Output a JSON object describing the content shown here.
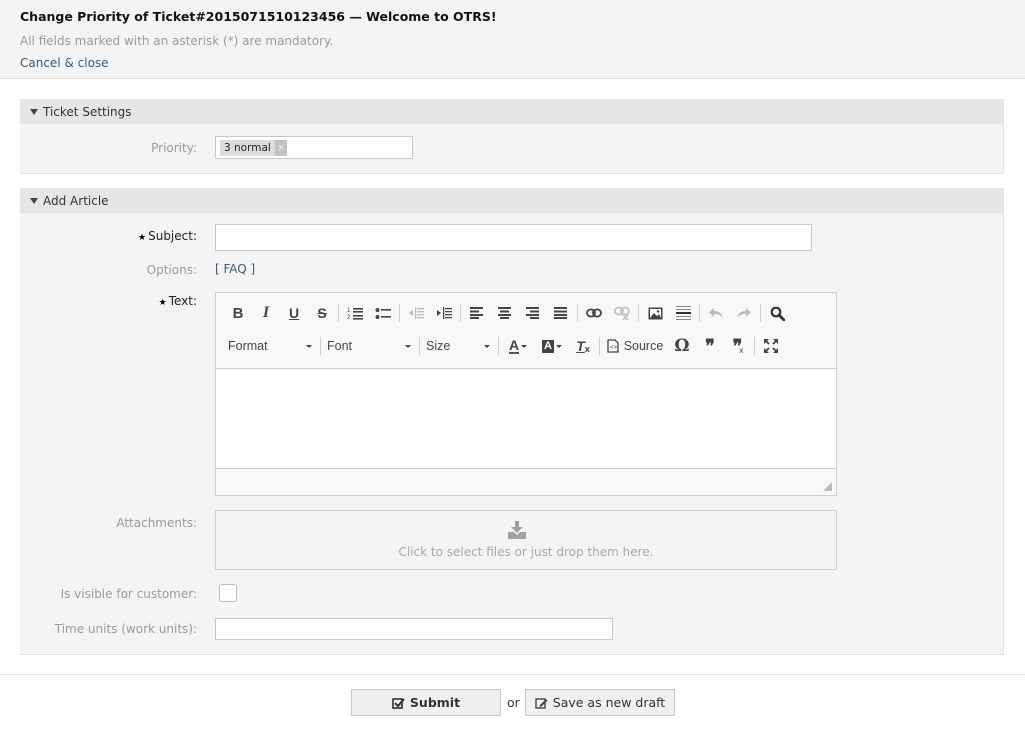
{
  "header": {
    "title": "Change Priority of Ticket#2015071510123456 — Welcome to OTRS!",
    "mandatory_note": "All fields marked with an asterisk (*) are mandatory.",
    "cancel_label": "Cancel & close"
  },
  "ticket_settings": {
    "title": "Ticket Settings",
    "priority_label": "Priority:",
    "priority_value": "3 normal",
    "remove_glyph": "x"
  },
  "add_article": {
    "title": "Add Article",
    "subject_label": "Subject:",
    "subject_value": "",
    "options_label": "Options:",
    "faq_link": "[ FAQ ]",
    "text_label": "Text:",
    "star": "★",
    "editor": {
      "row1": [
        {
          "name": "bold",
          "glyph": "B",
          "enabled": true
        },
        {
          "name": "italic",
          "glyph": "I",
          "enabled": true
        },
        {
          "name": "underline",
          "glyph": "U",
          "enabled": true
        },
        {
          "name": "strikethrough",
          "glyph": "S",
          "enabled": true
        },
        {
          "name": "numbered-list",
          "glyph": "1≡",
          "enabled": true
        },
        {
          "name": "bulleted-list",
          "glyph": "•≡",
          "enabled": true
        },
        {
          "name": "outdent",
          "glyph": "⇤",
          "enabled": false
        },
        {
          "name": "indent",
          "glyph": "⇥",
          "enabled": true
        },
        {
          "name": "align-left",
          "glyph": "≡",
          "enabled": true
        },
        {
          "name": "align-center",
          "glyph": "≡",
          "enabled": true
        },
        {
          "name": "align-right",
          "glyph": "≡",
          "enabled": true
        },
        {
          "name": "justify",
          "glyph": "≡",
          "enabled": true
        },
        {
          "name": "link",
          "glyph": "⊂⊃",
          "enabled": true
        },
        {
          "name": "unlink",
          "glyph": "⊘",
          "enabled": false
        },
        {
          "name": "image",
          "glyph": "▣",
          "enabled": true
        },
        {
          "name": "horizontal-line",
          "glyph": "☰",
          "enabled": true
        },
        {
          "name": "undo",
          "glyph": "↶",
          "enabled": false
        },
        {
          "name": "redo",
          "glyph": "↷",
          "enabled": false
        },
        {
          "name": "find",
          "glyph": "🔍",
          "enabled": true
        }
      ],
      "format_label": "Format",
      "font_label": "Font",
      "size_label": "Size",
      "text_color_glyph": "A",
      "bg_color_glyph": "A",
      "remove_format_glyph": "Tx",
      "source_label": "Source",
      "special_char_glyph": "Ω",
      "blockquote_glyph": "❞",
      "remove_blockquote_glyph": "❞",
      "maximize_glyph": "⤢",
      "body_text": ""
    },
    "attachments_label": "Attachments:",
    "dropzone_text": "Click to select files or just drop them here.",
    "visible_label": "Is visible for customer:",
    "visible_checked": false,
    "time_units_label": "Time units (work units):",
    "time_units_value": ""
  },
  "footer": {
    "submit_label": "Submit",
    "or_label": "or",
    "draft_label": "Save as new draft"
  }
}
